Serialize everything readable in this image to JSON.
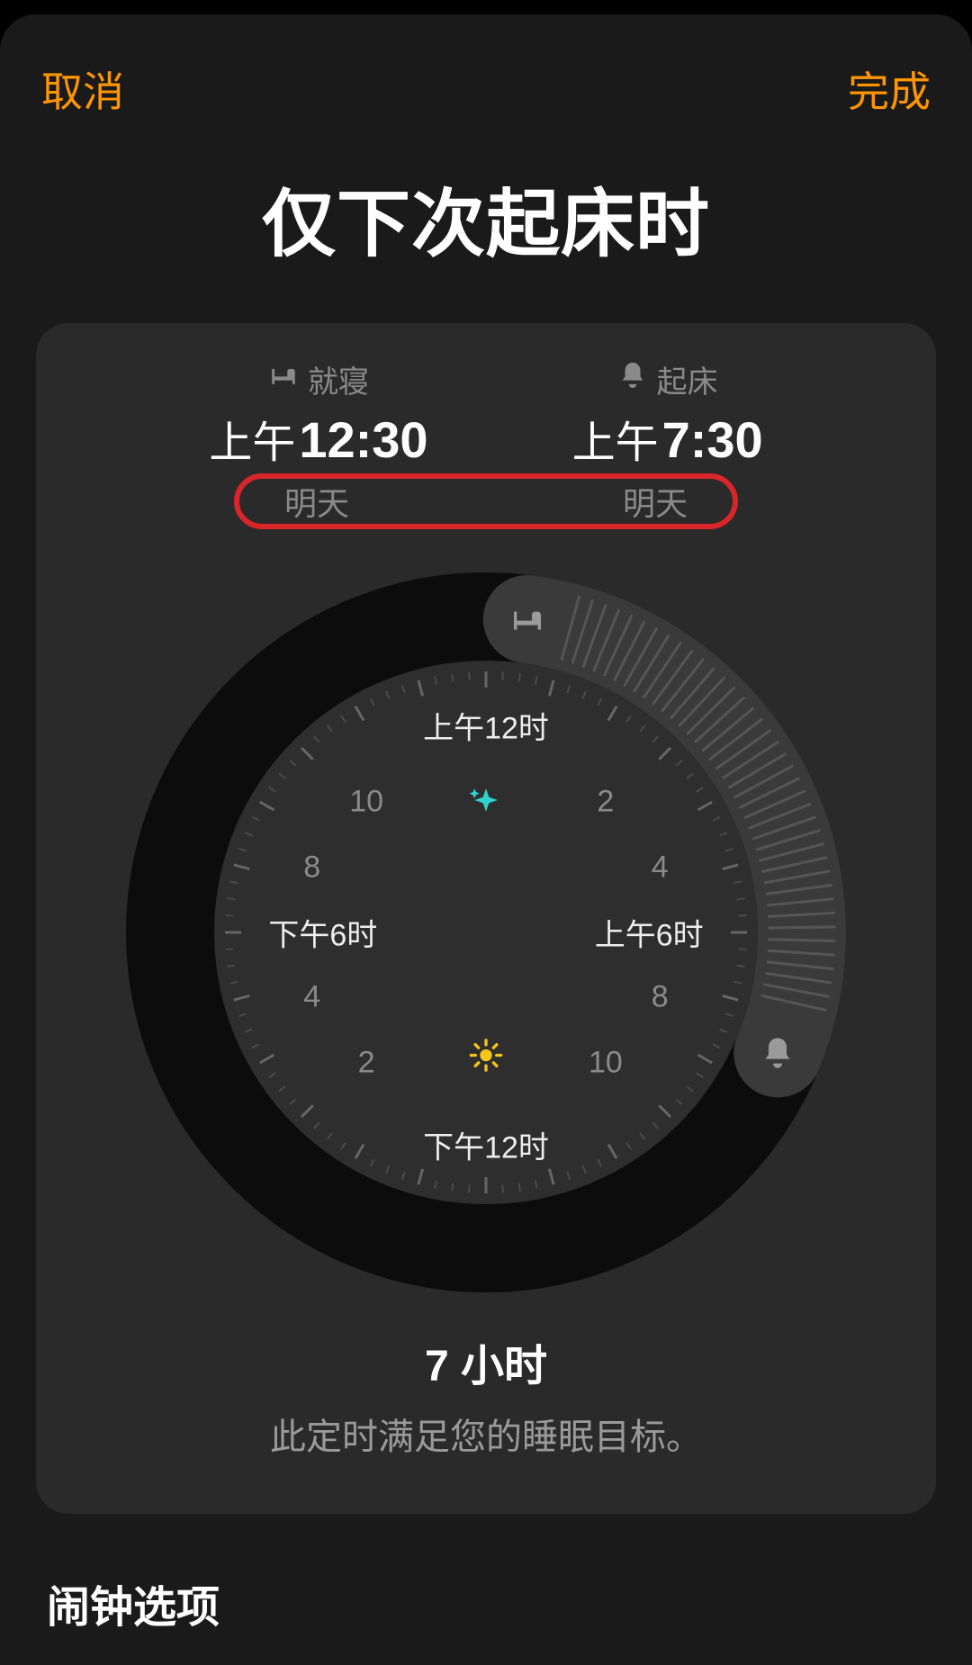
{
  "nav": {
    "cancel": "取消",
    "done": "完成"
  },
  "title": "仅下次起床时",
  "sleep": {
    "bedtime_label": "就寝",
    "bedtime_ampm": "上午",
    "bedtime_time": "12:30",
    "bedtime_tomorrow": "明天",
    "wake_label": "起床",
    "wake_ampm": "上午",
    "wake_time": "7:30",
    "wake_tomorrow": "明天"
  },
  "dial": {
    "top": "上午12时",
    "right": "上午6时",
    "bottom": "下午12时",
    "left": "下午6时",
    "n2": "2",
    "n4": "4",
    "n8": "8",
    "n10": "10",
    "bed_icon": "bed-icon",
    "alarm_icon": "bell-icon",
    "sparkle_icon": "sparkle-icon",
    "sun_icon": "sun-icon",
    "arc_start_deg": 7.5,
    "arc_end_deg": 112.5
  },
  "summary": {
    "duration": "7 小时",
    "goal_text": "此定时满足您的睡眠目标。"
  },
  "section": {
    "alarm_options": "闹钟选项"
  },
  "colors": {
    "accent": "#ff9500",
    "highlight_ring": "#d9252a"
  }
}
